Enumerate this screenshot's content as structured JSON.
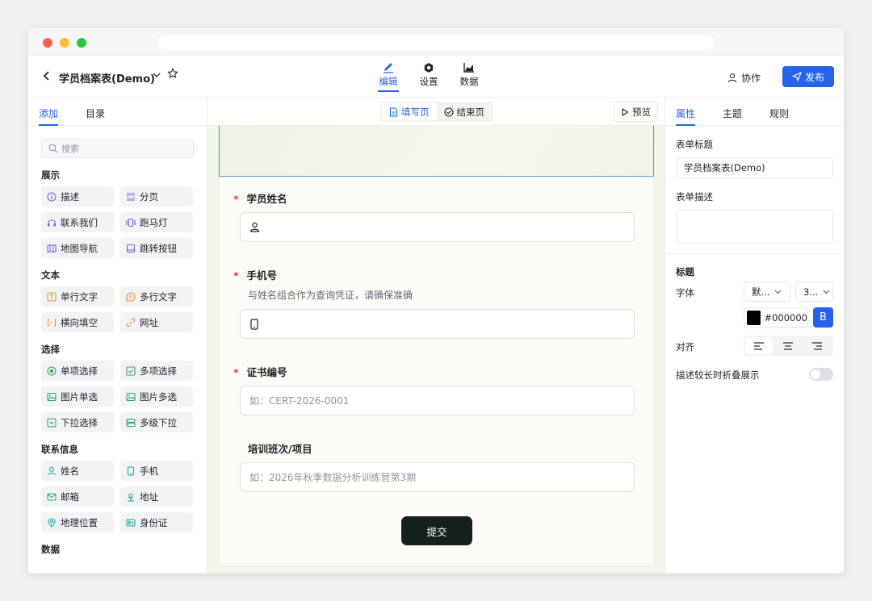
{
  "header": {
    "title": "学员档案表(Demo)",
    "mode_tabs": [
      {
        "label": "编辑",
        "active": true
      },
      {
        "label": "设置",
        "active": false
      },
      {
        "label": "数据",
        "active": false
      }
    ],
    "collab_label": "协作",
    "publish_label": "发布"
  },
  "left_panel": {
    "tabs": [
      {
        "label": "添加",
        "active": true
      },
      {
        "label": "目录",
        "active": false
      }
    ],
    "search_placeholder": "搜索",
    "groups": [
      {
        "title": "展示",
        "items": [
          {
            "label": "描述",
            "icon": "info-icon",
            "color": "#7c5cd6"
          },
          {
            "label": "分页",
            "icon": "page-break-icon",
            "color": "#7c5cd6"
          },
          {
            "label": "联系我们",
            "icon": "headset-icon",
            "color": "#7c5cd6"
          },
          {
            "label": "跑马灯",
            "icon": "marquee-icon",
            "color": "#7c5cd6"
          },
          {
            "label": "地图导航",
            "icon": "map-icon",
            "color": "#7c5cd6"
          },
          {
            "label": "跳转按钮",
            "icon": "button-icon",
            "color": "#7c5cd6"
          }
        ]
      },
      {
        "title": "文本",
        "items": [
          {
            "label": "单行文字",
            "icon": "text-icon",
            "color": "#e8912d"
          },
          {
            "label": "多行文字",
            "icon": "multiline-icon",
            "color": "#e8912d"
          },
          {
            "label": "横向填空",
            "icon": "fill-blank-icon",
            "color": "#e8912d"
          },
          {
            "label": "网址",
            "icon": "link-icon",
            "color": "#e8912d"
          }
        ]
      },
      {
        "title": "选择",
        "items": [
          {
            "label": "单项选择",
            "icon": "radio-icon",
            "color": "#2fa84f"
          },
          {
            "label": "多项选择",
            "icon": "checkbox-icon",
            "color": "#2fa84f"
          },
          {
            "label": "图片单选",
            "icon": "image-icon",
            "color": "#2fa84f"
          },
          {
            "label": "图片多选",
            "icon": "image-icon",
            "color": "#2fa84f"
          },
          {
            "label": "下拉选择",
            "icon": "dropdown-icon",
            "color": "#2fa84f"
          },
          {
            "label": "多级下拉",
            "icon": "cascade-icon",
            "color": "#2fa84f"
          }
        ]
      },
      {
        "title": "联系信息",
        "items": [
          {
            "label": "姓名",
            "icon": "user-icon",
            "color": "#1fa5a8"
          },
          {
            "label": "手机",
            "icon": "phone-icon",
            "color": "#1fa5a8"
          },
          {
            "label": "邮箱",
            "icon": "mail-icon",
            "color": "#1fa5a8"
          },
          {
            "label": "地址",
            "icon": "address-icon",
            "color": "#1fa5a8"
          },
          {
            "label": "地理位置",
            "icon": "location-icon",
            "color": "#1fa5a8"
          },
          {
            "label": "身份证",
            "icon": "id-card-icon",
            "color": "#1fa5a8"
          }
        ]
      },
      {
        "title": "数据",
        "items": []
      }
    ]
  },
  "canvas": {
    "page_tabs": [
      {
        "label": "填写页",
        "active": true
      },
      {
        "label": "结束页",
        "active": false
      }
    ],
    "preview_label": "预览",
    "fields": [
      {
        "label": "学员姓名",
        "required": true,
        "description": "",
        "placeholder": "",
        "icon": "user-icon"
      },
      {
        "label": "手机号",
        "required": true,
        "description": "与姓名组合作为查询凭证，请确保准确",
        "placeholder": "",
        "icon": "phone-icon"
      },
      {
        "label": "证书编号",
        "required": true,
        "description": "",
        "placeholder": "如：CERT-2026-0001",
        "icon": ""
      },
      {
        "label": "培训班次/项目",
        "required": false,
        "description": "",
        "placeholder": "如：2026年秋季数据分析训练营第3期",
        "icon": ""
      }
    ],
    "submit_label": "提交"
  },
  "right_panel": {
    "tabs": [
      {
        "label": "属性",
        "active": true
      },
      {
        "label": "主题",
        "active": false
      },
      {
        "label": "规则",
        "active": false
      }
    ],
    "form_title_label": "表单标题",
    "form_title_value": "学员档案表(Demo)",
    "form_desc_label": "表单描述",
    "form_desc_value": "",
    "section_title": "标题",
    "font_label": "字体",
    "font_family_value": "默...",
    "font_size_value": "3...",
    "color_value": "#000000",
    "bold_label": "B",
    "align_label": "对齐",
    "collapse_label": "描述较长时折叠展示",
    "collapse_on": false
  }
}
